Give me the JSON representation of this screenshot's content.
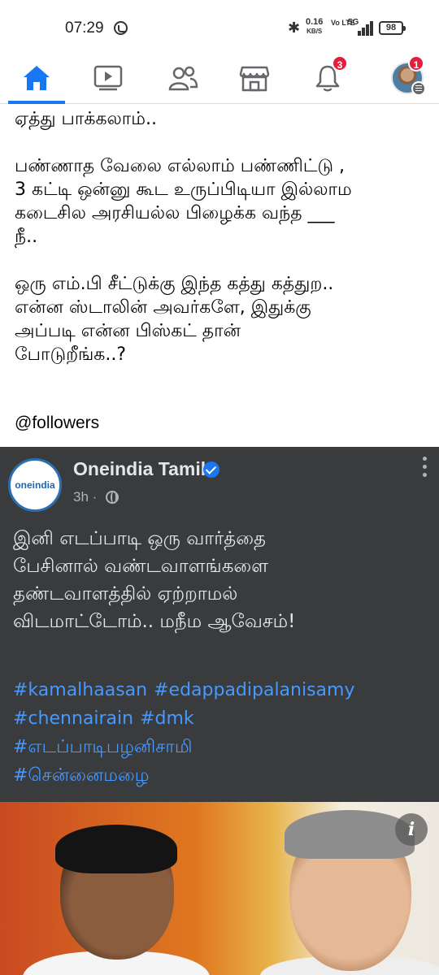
{
  "status_bar": {
    "time": "07:29",
    "net_speed": "0.16",
    "net_speed_unit": "KB/S",
    "volte": "Vo LTE",
    "network": "5G",
    "battery": "98"
  },
  "nav": {
    "items": [
      {
        "name": "home",
        "icon": "home-icon",
        "active": true
      },
      {
        "name": "watch",
        "icon": "video-icon"
      },
      {
        "name": "friends",
        "icon": "friends-icon"
      },
      {
        "name": "marketplace",
        "icon": "marketplace-icon"
      },
      {
        "name": "notifications",
        "icon": "bell-icon",
        "badge": "3"
      },
      {
        "name": "profile",
        "icon": "avatar",
        "badge": "1"
      }
    ],
    "accent": "#1877f2",
    "badge_color": "#e41e3f"
  },
  "post": {
    "lines": [
      "ஏத்து பாக்கலாம்..",
      "",
      "பண்ணாத வேலை எல்லாம் பண்ணிட்டு ,",
      "3 கட்டி ஒன்னு கூட உருப்பிடியா இல்லாம",
      "கடைசில அரசியல்ல பிழைக்க வந்த ___",
      "நீ..",
      "",
      "ஒரு எம்.பி சீட்டுக்கு இந்த கத்து கத்துற..",
      "என்ன ஸ்டாலின் அவர்களே, இதுக்கு",
      "அப்படி என்ன பிஸ்கட் தான்",
      "போடுறீங்க..?"
    ],
    "mention": "@followers"
  },
  "shared": {
    "logo_text": "oneindia",
    "page_name": "Oneindia Tamil",
    "time": "3h ·",
    "body_lines": [
      "இனி எடப்பாடி ஒரு வார்த்தை",
      "பேசினால் வண்டவாளங்களை",
      "தண்டவாளத்தில் ஏற்றாமல்",
      "விடமாட்டோம்.. மநீம ஆவேசம்!"
    ],
    "hashtags": [
      "#kamalhaasan",
      "#edappadipalanisamy",
      "#chennairain",
      "#dmk",
      "#எடப்பாடிபழனிசாமி",
      "#சென்னைமழை"
    ],
    "card_bg": "#3a3b3c",
    "hashtag_color": "#4599ff",
    "info_label": "i"
  }
}
